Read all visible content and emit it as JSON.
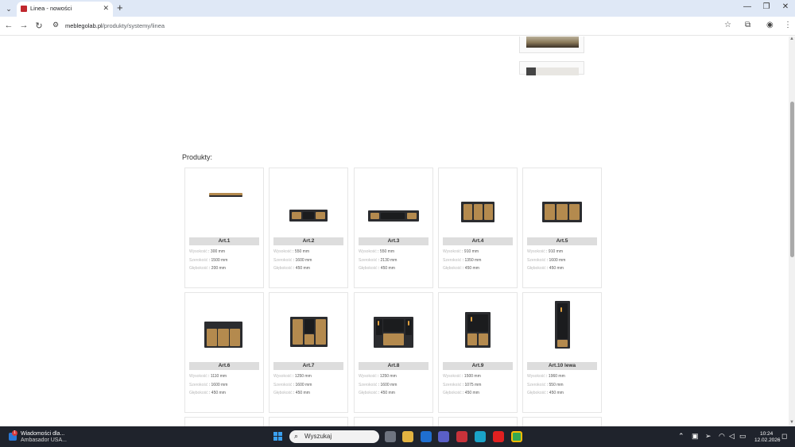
{
  "browser": {
    "tab_title": "Linea - nowości",
    "tab_close": "✕",
    "new_tab": "+",
    "url_host": "meblegolab.pl",
    "url_path": "/produkty/systemy/linea",
    "icons": [
      "tab-menu-icon",
      "favicon-icon",
      "back-icon",
      "forward-icon",
      "reload-icon",
      "site-info-icon",
      "bookmark-star-icon",
      "extensions-icon",
      "profile-icon",
      "more-menu-icon",
      "minimize-icon",
      "maximize-icon",
      "close-window-icon"
    ]
  },
  "page": {
    "section_title": "Produkty:",
    "products": [
      {
        "name": "Art.1",
        "specs": [
          {
            "k": "Wysokość",
            "v": "300 mm"
          },
          {
            "k": "Szerokość",
            "v": "1500 mm"
          },
          {
            "k": "Głębokość",
            "v": "200 mm"
          }
        ]
      },
      {
        "name": "Art.2",
        "specs": [
          {
            "k": "Wysokość",
            "v": "550 mm"
          },
          {
            "k": "Szerokość",
            "v": "1600 mm"
          },
          {
            "k": "Głębokość",
            "v": "450 mm"
          }
        ]
      },
      {
        "name": "Art.3",
        "specs": [
          {
            "k": "Wysokość",
            "v": "550 mm"
          },
          {
            "k": "Szerokość",
            "v": "2130 mm"
          },
          {
            "k": "Głębokość",
            "v": "450 mm"
          }
        ]
      },
      {
        "name": "Art.4",
        "specs": [
          {
            "k": "Wysokość",
            "v": "910 mm"
          },
          {
            "k": "Szerokość",
            "v": "1350 mm"
          },
          {
            "k": "Głębokość",
            "v": "450 mm"
          }
        ]
      },
      {
        "name": "Art.5",
        "specs": [
          {
            "k": "Wysokość",
            "v": "910 mm"
          },
          {
            "k": "Szerokość",
            "v": "1600 mm"
          },
          {
            "k": "Głębokość",
            "v": "450 mm"
          }
        ]
      },
      {
        "name": "Art.6",
        "specs": [
          {
            "k": "Wysokość",
            "v": "1110 mm"
          },
          {
            "k": "Szerokość",
            "v": "1600 mm"
          },
          {
            "k": "Głębokość",
            "v": "450 mm"
          }
        ]
      },
      {
        "name": "Art.7",
        "specs": [
          {
            "k": "Wysokość",
            "v": "1250 mm"
          },
          {
            "k": "Szerokość",
            "v": "1600 mm"
          },
          {
            "k": "Głębokość",
            "v": "450 mm"
          }
        ]
      },
      {
        "name": "Art.8",
        "specs": [
          {
            "k": "Wysokość",
            "v": "1250 mm"
          },
          {
            "k": "Szerokość",
            "v": "1600 mm"
          },
          {
            "k": "Głębokość",
            "v": "450 mm"
          }
        ]
      },
      {
        "name": "Art.9",
        "specs": [
          {
            "k": "Wysokość",
            "v": "1500 mm"
          },
          {
            "k": "Szerokość",
            "v": "1075 mm"
          },
          {
            "k": "Głębokość",
            "v": "450 mm"
          }
        ]
      },
      {
        "name": "Art.10 lewa",
        "specs": [
          {
            "k": "Wysokość",
            "v": "1960 mm"
          },
          {
            "k": "Szerokość",
            "v": "550 mm"
          },
          {
            "k": "Głębokość",
            "v": "450 mm"
          }
        ]
      }
    ]
  },
  "taskbar": {
    "news_title": "Wiadomości dla...",
    "news_subtitle": "Ambasador USA...",
    "news_badge": "1",
    "search_placeholder": "Wyszukaj",
    "time": "10:24",
    "date": "12.02.2026",
    "colors": {
      "taskbar_bg": "#1f232c",
      "start_blue": "#3aa0f0"
    }
  },
  "colors": {
    "oak": "#b48a4e",
    "dark_body": "#2b2c2f",
    "label_bg": "#dddddd",
    "tab_strip": "#dfe8f6"
  }
}
